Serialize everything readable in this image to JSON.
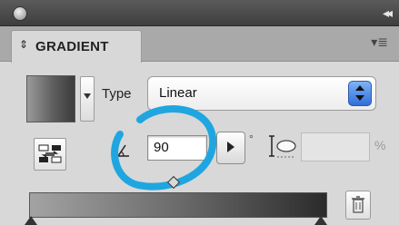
{
  "panel": {
    "tab_title": "GRADIENT",
    "tab_arrows": "⇕",
    "menu_glyph": "▾≣",
    "collapse_glyph": "◂◂"
  },
  "gradient": {
    "type_label": "Type",
    "type_value": "Linear",
    "angle_value": "90",
    "angle_unit": "°",
    "aspect_value": "",
    "aspect_unit": "%"
  },
  "colors": {
    "highlight": "#1fa6e0",
    "stepper_blue": "#2f6fd8",
    "gradient_start": "#a3a3a3",
    "gradient_end": "#2b2b2b"
  }
}
